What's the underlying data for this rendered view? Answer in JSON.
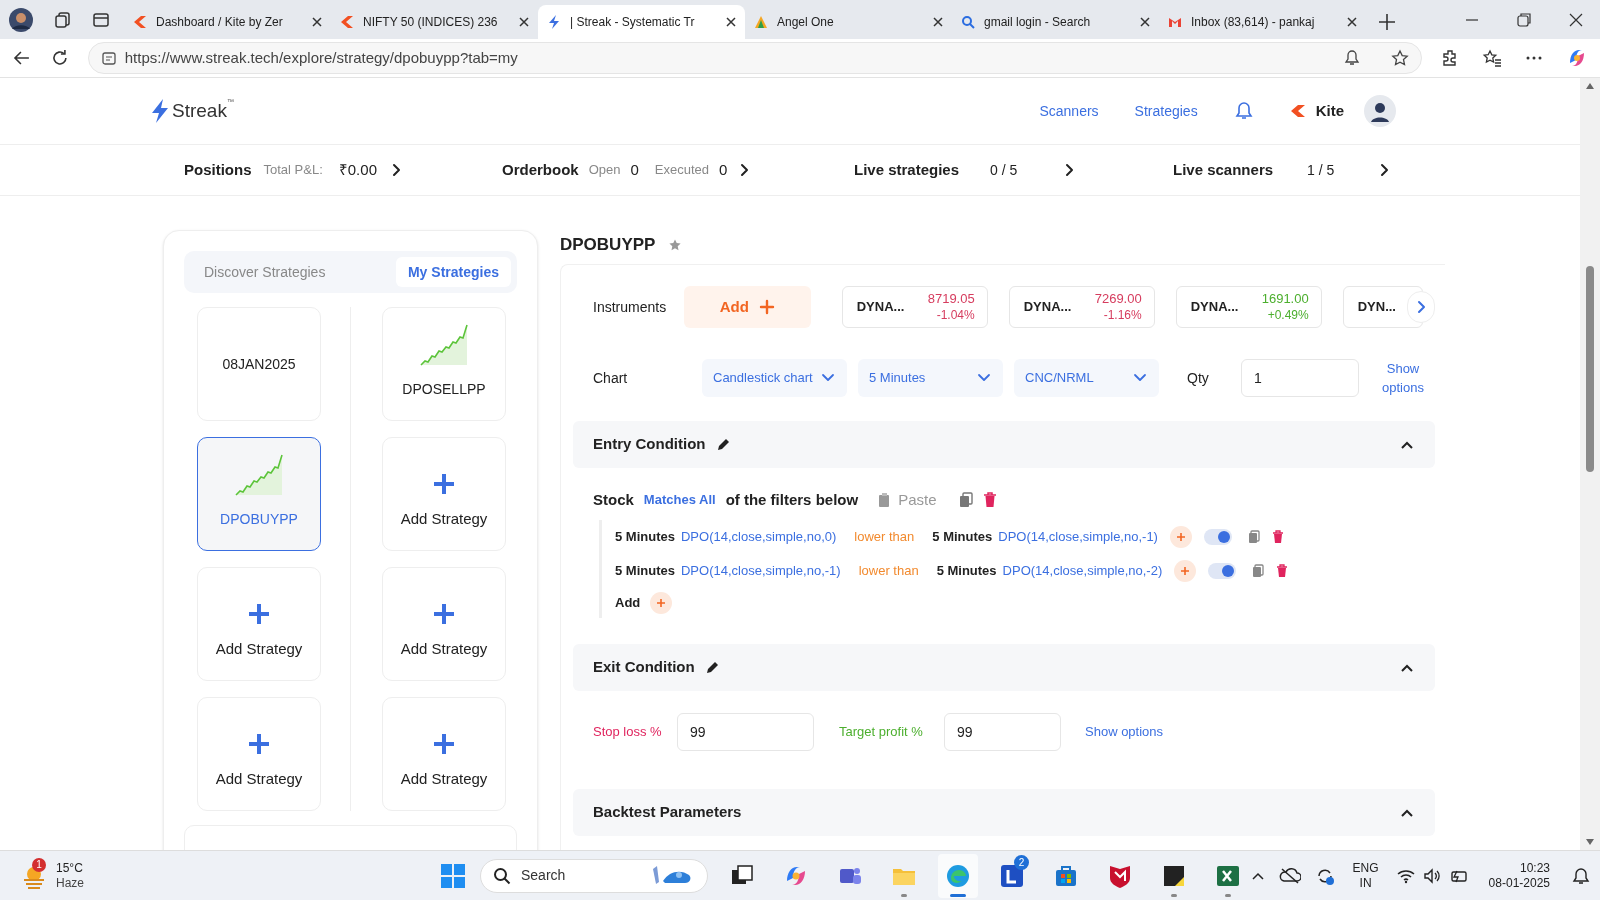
{
  "browser": {
    "tabs": [
      {
        "title": "Dashboard / Kite by Zer",
        "kind": "kite",
        "selected": false
      },
      {
        "title": "NIFTY 50 (INDICES) 236",
        "kind": "kite",
        "selected": false
      },
      {
        "title": "| Streak - Systematic Tr",
        "kind": "streak",
        "selected": true
      },
      {
        "title": "Angel One",
        "kind": "angel",
        "selected": false
      },
      {
        "title": "gmail login - Search",
        "kind": "search",
        "selected": false
      },
      {
        "title": "Inbox (83,614) - pankaj",
        "kind": "gmail",
        "selected": false
      }
    ],
    "address": "https://www.streak.tech/explore/strategy/dpobuypp?tab=my"
  },
  "header": {
    "logo": "Streak",
    "logo_mark": "™",
    "nav": [
      "Scanners",
      "Strategies"
    ],
    "broker": "Kite"
  },
  "summary": {
    "positions": {
      "label": "Positions",
      "pnl_label": "Total P&L:",
      "pnl": "₹0.00"
    },
    "orderbook": {
      "label": "Orderbook",
      "open_label": "Open",
      "open": "0",
      "executed_label": "Executed",
      "executed": "0"
    },
    "live_strategies": {
      "label": "Live strategies",
      "count": "0 / 5"
    },
    "live_scanners": {
      "label": "Live scanners",
      "count": "1 / 5"
    }
  },
  "sidebar": {
    "tabs": [
      {
        "label": "Discover Strategies",
        "selected": false
      },
      {
        "label": "My Strategies",
        "selected": true
      }
    ],
    "cards": [
      {
        "kind": "text",
        "label": "08JAN2025",
        "selected": false
      },
      {
        "kind": "chart",
        "label": "DPOSELLPP",
        "selected": false
      },
      {
        "kind": "chart",
        "label": "DPOBUYPP",
        "selected": true
      },
      {
        "kind": "add",
        "label": "Add Strategy",
        "selected": false
      },
      {
        "kind": "add",
        "label": "Add Strategy",
        "selected": false
      },
      {
        "kind": "add",
        "label": "Add Strategy",
        "selected": false
      },
      {
        "kind": "add",
        "label": "Add Strategy",
        "selected": false
      },
      {
        "kind": "add",
        "label": "Add Strategy",
        "selected": false
      }
    ]
  },
  "strategy": {
    "title": "DPOBUYPP",
    "instruments": {
      "label": "Instruments",
      "add": "Add",
      "items": [
        {
          "name": "DYNA...",
          "price": "8719.05",
          "change": "-1.04%",
          "color": "#d63c5e"
        },
        {
          "name": "DYNA...",
          "price": "7269.00",
          "change": "-1.16%",
          "color": "#d63c5e"
        },
        {
          "name": "DYNA...",
          "price": "1691.00",
          "change": "+0.49%",
          "color": "#4caf2e"
        },
        {
          "name": "DYN..."
        }
      ]
    },
    "chart_row": {
      "label": "Chart",
      "dropdowns": [
        "Candlestick chart",
        "5 Minutes",
        "CNC/NRML"
      ],
      "qty_label": "Qty",
      "qty": "1",
      "show_options": "Show options"
    },
    "entry": {
      "title": "Entry Condition",
      "expanded": true,
      "subject": "Stock",
      "match": "Matches All",
      "suffix": "of the filters below",
      "paste": "Paste",
      "conditions": [
        {
          "left_tf": "5 Minutes",
          "left": "DPO(14,close,simple,no,0)",
          "op": "lower than",
          "right_tf": "5 Minutes",
          "right": "DPO(14,close,simple,no,-1)",
          "on": true
        },
        {
          "left_tf": "5 Minutes",
          "left": "DPO(14,close,simple,no,-1)",
          "op": "lower than",
          "right_tf": "5 Minutes",
          "right": "DPO(14,close,simple,no,-2)",
          "on": true
        }
      ],
      "add": "Add"
    },
    "exit": {
      "title": "Exit Condition",
      "expanded": true,
      "stop_loss_label": "Stop loss %",
      "stop_loss": "99",
      "target_label": "Target profit %",
      "target": "99",
      "show_options": "Show options"
    },
    "backtest": {
      "title": "Backtest Parameters",
      "expanded": true
    }
  },
  "taskbar": {
    "weather": {
      "temp": "15°C",
      "text": "Haze",
      "badge": "1"
    },
    "search": "Search",
    "apps": [
      {
        "kind": "taskview",
        "running": false,
        "active": false
      },
      {
        "kind": "copilot",
        "running": false,
        "active": false
      },
      {
        "kind": "teams",
        "running": false,
        "active": false
      },
      {
        "kind": "folder",
        "running": true,
        "active": false
      },
      {
        "kind": "edge",
        "running": true,
        "active": true
      },
      {
        "kind": "letter",
        "badge": "2",
        "running": false,
        "active": false
      },
      {
        "kind": "store",
        "running": false,
        "active": false
      },
      {
        "kind": "shield",
        "running": false,
        "active": false
      },
      {
        "kind": "notes",
        "running": true,
        "active": false
      },
      {
        "kind": "excel",
        "running": true,
        "active": false
      }
    ],
    "lang": "ENG",
    "region": "IN",
    "time": "10:23",
    "date": "08-01-2025"
  }
}
